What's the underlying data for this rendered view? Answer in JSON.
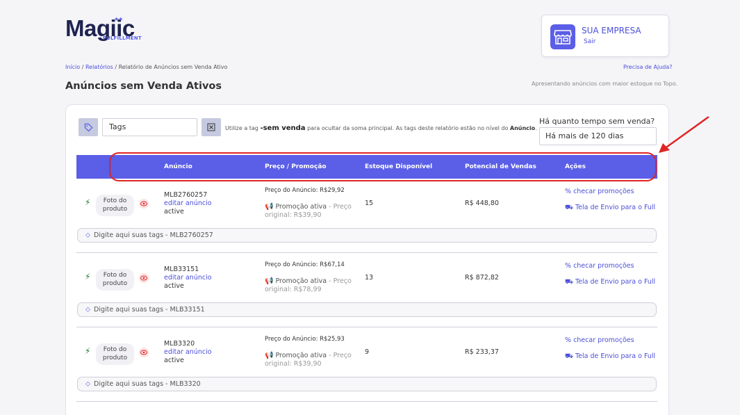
{
  "brand": {
    "name": "Magiic",
    "sub": "FULFILLMENT"
  },
  "company": {
    "name": "SUA EMPRESA",
    "logout": "Sair"
  },
  "breadcrumb": {
    "home": "Início",
    "reports": "Relatórios",
    "current": "Relatório de Anúncios sem Venda Ativo"
  },
  "help": "Precisa de Ajuda?",
  "page": {
    "title": "Anúncios sem Venda Ativos",
    "subtitle": "Apresentando anúncios com maior estoque no Topo."
  },
  "filter": {
    "tags_placeholder": "Tags",
    "hint_prefix": "Utilize a tag",
    "hint_tag": "-sem venda",
    "hint_middle": "para ocultar da soma principal. As tags deste relatório estão no nível do",
    "hint_level": "Anúncio",
    "hint_suffix": ".",
    "time_label": "Há quanto tempo sem venda?",
    "time_value": "Há mais de 120 dias"
  },
  "table": {
    "headers": [
      "Anúncio",
      "Preço / Promoção",
      "Estoque Disponível",
      "Potencial de Vendas",
      "Ações"
    ],
    "photo_label": "Foto do produto",
    "edit_label": "editar anúncio",
    "promo_label": "Promoção ativa",
    "action_promo": "checar promoções",
    "action_full": "Tela de Envio para o Full",
    "rows": [
      {
        "sku": "MLB2760257",
        "status": "active",
        "price": "Preço do Anúncio: R$29,92",
        "original": "- Preço original: R$39,90",
        "stock": "15",
        "potential": "R$ 448,80",
        "tags": "Digite aqui suas tags - MLB2760257"
      },
      {
        "sku": "MLB33151",
        "status": "active",
        "price": "Preço do Anúncio: R$67,14",
        "original": "- Preço original: R$78,99",
        "stock": "13",
        "potential": "R$ 872,82",
        "tags": "Digite aqui suas tags - MLB33151"
      },
      {
        "sku": "MLB3320",
        "status": "active",
        "price": "Preço do Anúncio: R$25,93",
        "original": "- Preço original: R$39,90",
        "stock": "9",
        "potential": "R$ 233,37",
        "tags": "Digite aqui suas tags - MLB3320"
      }
    ]
  },
  "colors": {
    "accent": "#5b5ee6",
    "highlight": "#e02424",
    "bolt": "#1b7a2b"
  }
}
